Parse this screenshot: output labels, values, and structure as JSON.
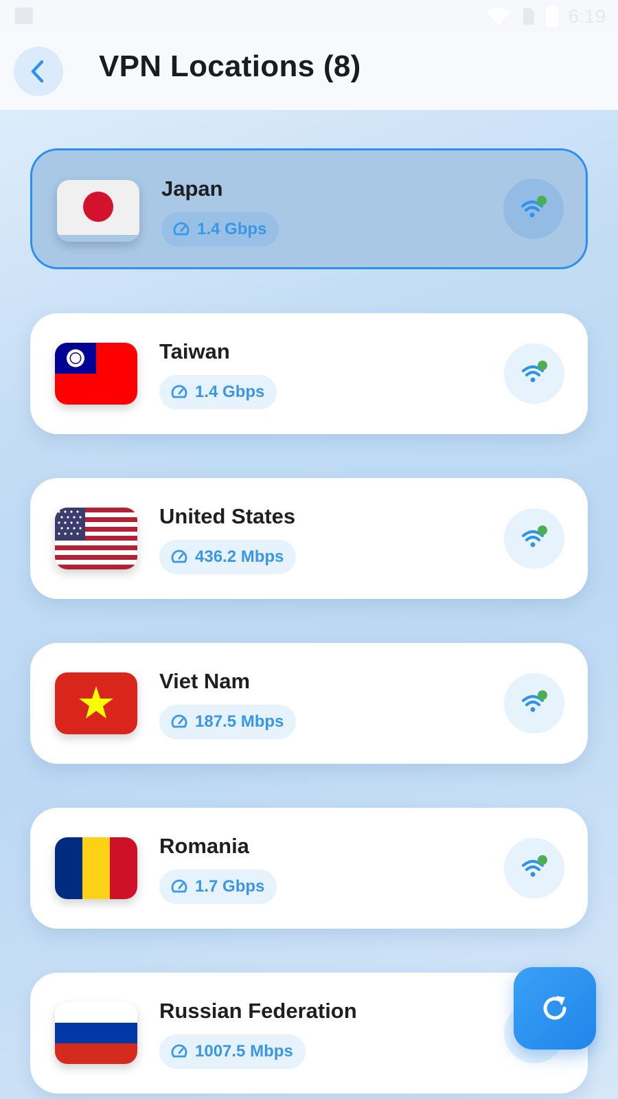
{
  "status_bar": {
    "time": "6:19"
  },
  "header": {
    "title": "VPN Locations (8)"
  },
  "locations": [
    {
      "name": "Japan",
      "speed": "1.4 Gbps",
      "selected": true
    },
    {
      "name": "Taiwan",
      "speed": "1.4 Gbps",
      "selected": false
    },
    {
      "name": "United States",
      "speed": "436.2 Mbps",
      "selected": false
    },
    {
      "name": "Viet Nam",
      "speed": "187.5 Mbps",
      "selected": false
    },
    {
      "name": "Romania",
      "speed": "1.7 Gbps",
      "selected": false
    },
    {
      "name": "Russian Federation",
      "speed": "1007.5 Mbps",
      "selected": false
    }
  ],
  "icons": {
    "back": "chevron-left-icon",
    "speed": "speedometer-icon",
    "signal": "wifi-signal-icon",
    "refresh": "refresh-icon"
  },
  "colors": {
    "accent": "#2a8ff0",
    "speed_text": "#3a96e6",
    "online_dot": "#4caf50"
  }
}
